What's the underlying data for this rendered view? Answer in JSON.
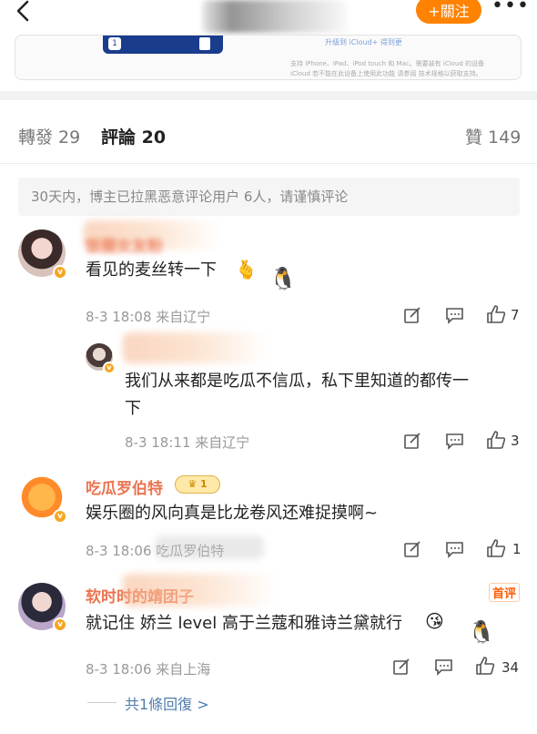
{
  "header": {
    "follow_label": "+關注",
    "more_label": "•••"
  },
  "card": {
    "caption_top": "升级到 iCloud+ 得到更",
    "caption_body": "支持 iPhone、iPad、iPod touch 和 Mac。需要装有 iCloud 的设备 iCloud 若不能在此设备上使用此功能 请参阅 技术规格以获取支持。"
  },
  "tabs": [
    {
      "label": "轉發 29",
      "active": false
    },
    {
      "label": "評論 20",
      "active": true
    },
    {
      "label": "贊 149",
      "active": false
    }
  ],
  "notice": "30天内，博主已拉黑恶意评论用户 6人，请谨慎评论",
  "comments": [
    {
      "username": "饭圈女友粉",
      "text": "看见的麦丝转一下",
      "meta": "8-3 18:08 来自辽宁",
      "likes": "7"
    },
    {
      "username": "",
      "text_line1": "我们从来都是吃瓜不信瓜，私下里知道的都传一",
      "text_line2": "下",
      "meta": "8-3 18:11 来自辽宁",
      "likes": "3"
    },
    {
      "username": "吃瓜罗伯特",
      "level": "1",
      "text": "娱乐圈的风向真是比龙卷风还难捉摸啊~",
      "meta": "8-3 18:06 吃瓜罗伯特",
      "likes": "1"
    },
    {
      "username": "软时时的靖团子",
      "tag": "首评",
      "text": "就记住 娇兰 level 高于兰蔻和雅诗兰黛就行",
      "meta": "8-3 18:06 来自上海",
      "likes": "34",
      "reply_link": "共1條回復 >"
    }
  ]
}
